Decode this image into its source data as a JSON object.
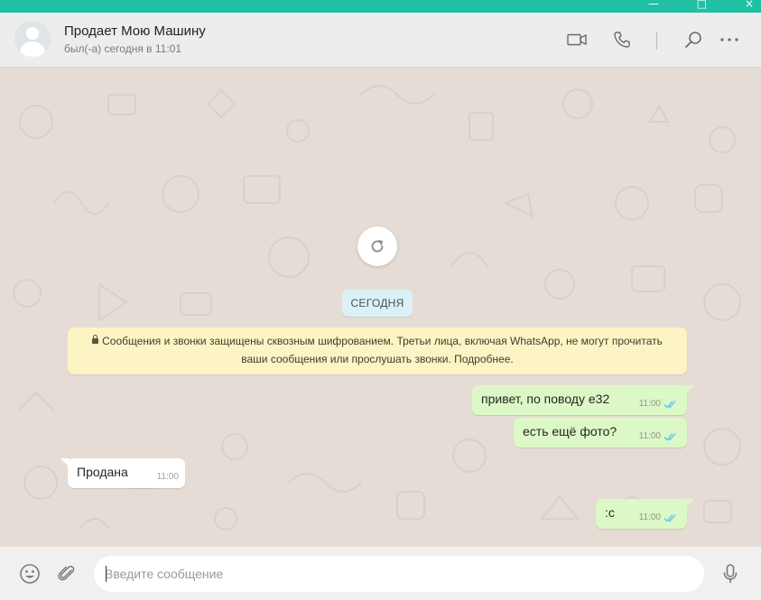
{
  "window": {
    "controls": [
      "—",
      "□",
      "×"
    ]
  },
  "header": {
    "title": "Продает Мою Машину",
    "status": "был(-а) сегодня в 11:01",
    "icons": [
      "video-call-icon",
      "voice-call-icon",
      "search-icon",
      "menu-icon"
    ]
  },
  "chat": {
    "date_label": "СЕГОДНЯ",
    "encryption_notice_line1": "Сообщения и звонки защищены сквозным шифрованием. Третьи лица, включая WhatsApp, не могут прочитать",
    "encryption_notice_line2": "ваши сообщения или прослушать звонки. Подробнее.",
    "messages": [
      {
        "direction": "out",
        "text": "привет, по поводу е32",
        "time": "11:00",
        "status": "read"
      },
      {
        "direction": "out",
        "text": "есть ещё фото?",
        "time": "11:00",
        "status": "read"
      },
      {
        "direction": "in",
        "text": "Продана",
        "time": "11:00"
      },
      {
        "direction": "out",
        "text": ":c",
        "time": "11:00",
        "status": "read"
      }
    ]
  },
  "composer": {
    "placeholder": "Введите сообщение"
  },
  "colors": {
    "accent": "#21c0a4",
    "outgoing": "#dcf8c6",
    "incoming": "#ffffff",
    "read_ticks": "#4fc3f7",
    "notice": "#fcf4c4",
    "date_pill": "#dcf0f8"
  }
}
